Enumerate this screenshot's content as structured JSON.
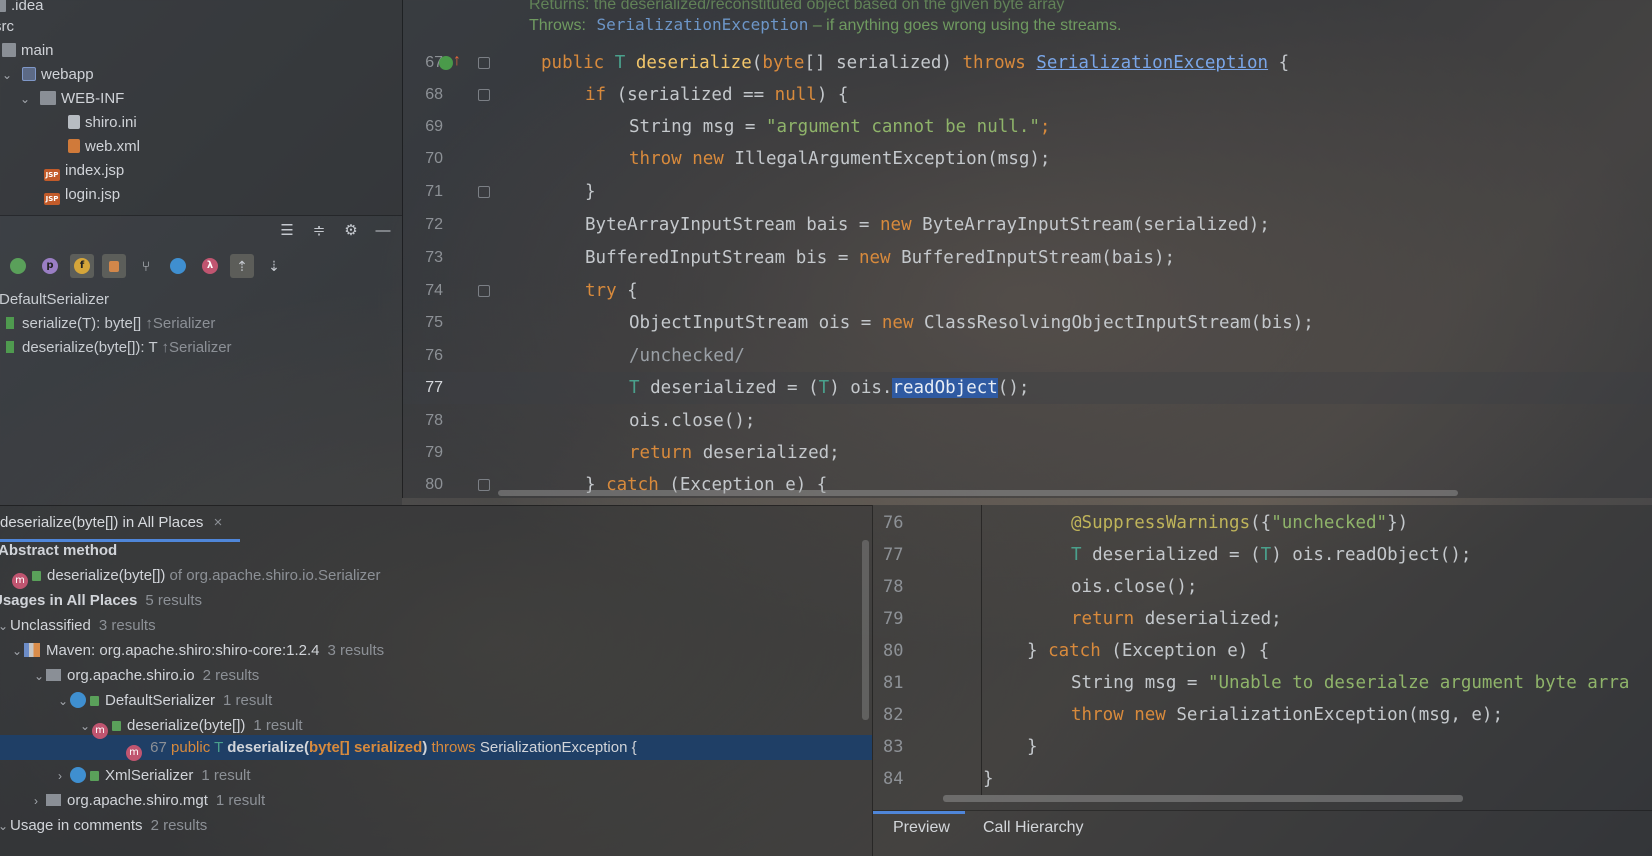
{
  "project_tree": {
    "items": [
      {
        "label": ".idea",
        "icon": "folder-icon"
      },
      {
        "label": "src",
        "icon": "folder-icon"
      },
      {
        "label": "main",
        "icon": "folder-icon"
      },
      {
        "label": "webapp",
        "icon": "web-folder-icon"
      },
      {
        "label": "WEB-INF",
        "icon": "folder-icon"
      },
      {
        "label": "shiro.ini",
        "icon": "file-icon"
      },
      {
        "label": "web.xml",
        "icon": "xml-file-icon"
      },
      {
        "label": "index.jsp",
        "icon": "jsp-file-icon"
      },
      {
        "label": "login.jsp",
        "icon": "jsp-file-icon"
      }
    ]
  },
  "structure": {
    "class_name": "DefaultSerializer",
    "jsp_badge": "JSP",
    "toolbar_icons": [
      "expand-all-icon",
      "collapse-all-icon",
      "gear-icon",
      "minimize-icon"
    ],
    "filter_icons": [
      "inherited-icon",
      "properties-icon",
      "fields-icon",
      "non-public-icon",
      "hierarchy-icon",
      "anonymous-icon",
      "lambda-icon",
      "navigate-icon",
      "autoscroll-icon"
    ],
    "filter_letters": {
      "p": "p",
      "f": "f",
      "lambda": "λ"
    },
    "members": [
      {
        "name": "serialize(T): byte[]",
        "overrides": "↑Serializer"
      },
      {
        "name": "deserialize(byte[]): T",
        "overrides": "↑Serializer"
      }
    ]
  },
  "editor": {
    "doc_returns": "Returns: the deserialized/reconstituted object based on the given byte array",
    "doc_throws_label": "Throws:",
    "doc_throws_class": "SerializationException",
    "doc_throws_desc": " – if anything goes wrong using the streams.",
    "line_numbers": [
      "67",
      "68",
      "69",
      "70",
      "71",
      "72",
      "73",
      "74",
      "75",
      "76",
      "77",
      "78",
      "79",
      "80"
    ],
    "tokens": {
      "public": "public",
      "T": "T",
      "deserialize": "deserialize",
      "byte": "byte",
      "sig_args": "[] serialized) ",
      "throws": "throws",
      "ser_ex": "SerializationException",
      "brace": " {",
      "l68_if": "if",
      "l68_rest": " (serialized == ",
      "null": "null",
      "l68_end": ") {",
      "l69_a": "String msg = ",
      "l69_str": "\"argument cannot be null.\"",
      "semi": ";",
      "throw": "throw",
      "new": "new",
      "l70_rest": " IllegalArgumentException(msg);",
      "l71": "}",
      "l72_a": "ByteArrayInputStream bais = ",
      "l72_b": " ByteArrayInputStream(serialized);",
      "l73_a": "BufferedInputStream bis = ",
      "l73_b": " BufferedInputStream(bais);",
      "try": "try",
      "l74_rest": " {",
      "l75_a": "ObjectInputStream ois = ",
      "l75_b": " ClassResolvingObjectInputStream(bis);",
      "l76": "/unchecked/",
      "l77_a": " deserialized = (",
      "l77_b": ") ois.",
      "l77_sel": "readObject",
      "l77_c": "();",
      "l78": "ois.close();",
      "return": "return",
      "l79_rest": " deserialized;",
      "l80_a": "} ",
      "catch": "catch",
      "l80_b": " (Exception e) {"
    }
  },
  "usages": {
    "tab_title": "deserialize(byte[]) in All Places",
    "close_icon": "×",
    "rows": [
      {
        "label": "Abstract method",
        "count": ""
      },
      {
        "label": "deserialize(byte[])",
        "suffix": " of org.apache.shiro.io.Serializer"
      },
      {
        "label": "Usages in All Places",
        "count": "5 results"
      },
      {
        "label": "Unclassified",
        "count": "3 results"
      },
      {
        "label": "Maven: org.apache.shiro:shiro-core:1.2.4",
        "count": "3 results"
      },
      {
        "label": "org.apache.shiro.io",
        "count": "2 results"
      },
      {
        "label": "DefaultSerializer",
        "count": "1 result"
      },
      {
        "label": "deserialize(byte[])",
        "count": "1 result"
      },
      {
        "label": "XmlSerializer",
        "count": "1 result"
      },
      {
        "label": "org.apache.shiro.mgt",
        "count": "1 result"
      },
      {
        "label": "Usage in comments",
        "count": "2 results"
      }
    ],
    "selected": {
      "line": "67",
      "public": "public",
      "T": "T",
      "method": "deserialize",
      "paren_open": "(",
      "byte_arg": "byte[] serialized",
      "paren_close": ")",
      "throws": "throws",
      "exception": "SerializationException",
      "brace": "{"
    },
    "method_badge": "m"
  },
  "preview": {
    "line_numbers": [
      "76",
      "77",
      "78",
      "79",
      "80",
      "81",
      "82",
      "83",
      "84"
    ],
    "tokens": {
      "ann": "@SuppressWarnings",
      "ann_a": "({",
      "ann_str": "\"unchecked\"",
      "ann_b": "})",
      "T": "T",
      "l77_a": " deserialized = (",
      "l77_b": ") ois.readObject();",
      "l78": "ois.close();",
      "return": "return",
      "l79_rest": " deserialized;",
      "l80_a": "} ",
      "catch": "catch",
      "l80_b": " (Exception e) {",
      "l81_a": "String msg = ",
      "l81_str": "\"Unable to deserialze argument byte arra",
      "throw": "throw",
      "new": "new",
      "l82_rest": " SerializationException(msg, e);",
      "l83": "}",
      "l84": "}"
    },
    "tabs": [
      "Preview",
      "Call Hierarchy"
    ]
  }
}
